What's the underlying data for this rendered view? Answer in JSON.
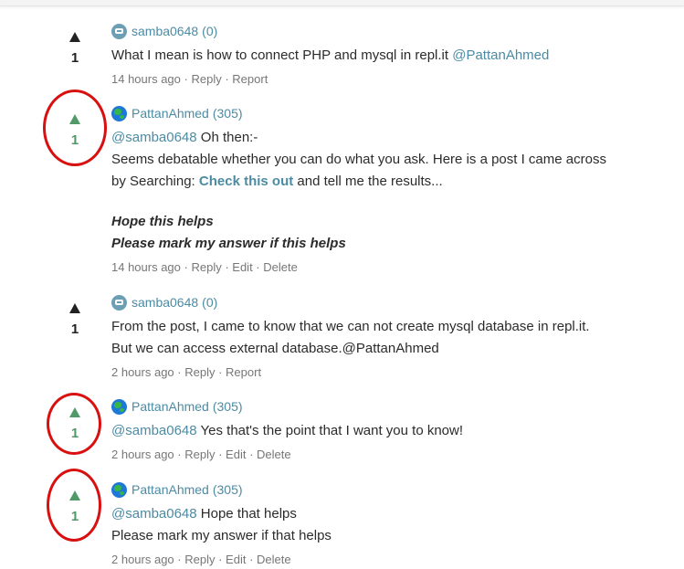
{
  "comments": [
    {
      "author": "samba0648",
      "rep": "(0)",
      "votes": "1",
      "line1_text": "What I mean is how to connect PHP and mysql in repl.it ",
      "line1_mention": "@PattanAhmed",
      "time": "14 hours ago",
      "actions": [
        "Reply",
        "Report"
      ]
    },
    {
      "author": "PattanAhmed",
      "rep": "(305)",
      "votes": "1",
      "mention": "@samba0648",
      "after_mention": " Oh then:-",
      "p1": "Seems debatable whether you can do what you ask. Here is a post I came across",
      "p2_before": "by Searching: ",
      "p2_link": "Check this out",
      "p2_after": " and tell me the results...",
      "em1": "Hope this helps",
      "em2": "Please mark my answer if this helps",
      "time": "14 hours ago",
      "actions": [
        "Reply",
        "Edit",
        "Delete"
      ]
    },
    {
      "author": "samba0648",
      "rep": "(0)",
      "votes": "1",
      "line1": "From the post, I came to know that we can not create mysql database in repl.it.",
      "line2": "But we can access external database.@PattanAhmed",
      "time": "2 hours ago",
      "actions": [
        "Reply",
        "Report"
      ]
    },
    {
      "author": "PattanAhmed",
      "rep": "(305)",
      "votes": "1",
      "mention": "@samba0648",
      "after_mention": " Yes that's the point that I want you to know!",
      "time": "2 hours ago",
      "actions": [
        "Reply",
        "Edit",
        "Delete"
      ]
    },
    {
      "author": "PattanAhmed",
      "rep": "(305)",
      "votes": "1",
      "mention": "@samba0648",
      "after_mention": " Hope that helps",
      "line2": "Please mark my answer if that helps",
      "time": "2 hours ago",
      "actions": [
        "Reply",
        "Edit",
        "Delete"
      ]
    }
  ],
  "separator": " · ",
  "colors": {
    "link": "#4c8ba3",
    "upvoted": "#4f9a67",
    "annotation_ring": "#d81010"
  },
  "icons": {
    "robot_avatar": "robot-avatar-icon",
    "globe_avatar": "globe-avatar-icon",
    "upvote": "upvote-arrow-icon"
  }
}
